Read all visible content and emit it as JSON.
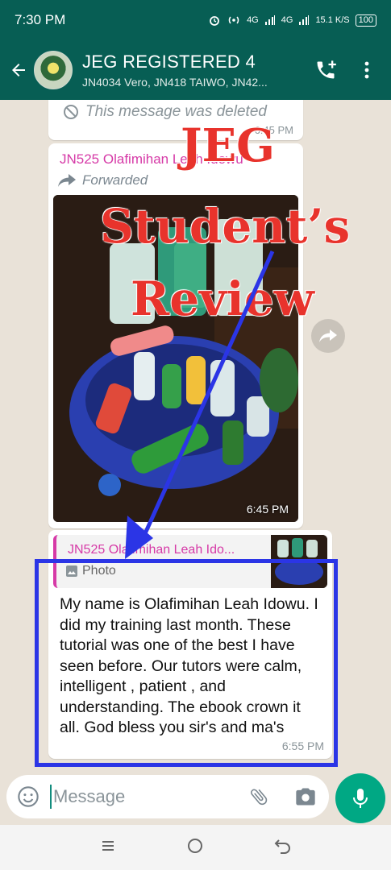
{
  "status_bar": {
    "time": "7:30 PM",
    "net1": "4G",
    "net2": "4G",
    "speed": "15.1 K/S",
    "battery": "100"
  },
  "header": {
    "title": "JEG REGISTERED 4",
    "members": "JN4034 Vero, JN418 TAIWO, JN42..."
  },
  "messages": {
    "deleted": {
      "text": "This message was deleted",
      "time": "6:45 PM"
    },
    "forwarded": {
      "sender": "JN525 Olafimihan Leah Idowu",
      "forwarded_label": "Forwarded",
      "time": "6:45 PM"
    },
    "reply": {
      "quote_sender": "JN525 Olafimihan Leah Ido...",
      "quote_type": "Photo",
      "text": "My name is Olafimihan Leah Idowu. I did my training last month. These tutorial was one of the best I have seen before. Our tutors were  calm, intelligent , patient , and understanding. The ebook crown it all. God bless you sir's and ma's",
      "time": "6:55 PM"
    }
  },
  "overlay": {
    "line1": "JEG",
    "line2": "Student’s",
    "line3": "Review",
    "color": "#e8332c",
    "annotation_color": "#2b35e6"
  },
  "input": {
    "placeholder": "Message"
  },
  "colors": {
    "header": "#075e54",
    "accent": "#00a884",
    "sender": "#d63aa7"
  },
  "icons": [
    "back-arrow-icon",
    "add-call-icon",
    "more-vert-icon",
    "blocked-icon",
    "forward-icon",
    "share-icon",
    "image-icon",
    "emoji-icon",
    "attach-icon",
    "camera-icon",
    "mic-icon",
    "recents-icon",
    "home-icon",
    "nav-back-icon"
  ]
}
